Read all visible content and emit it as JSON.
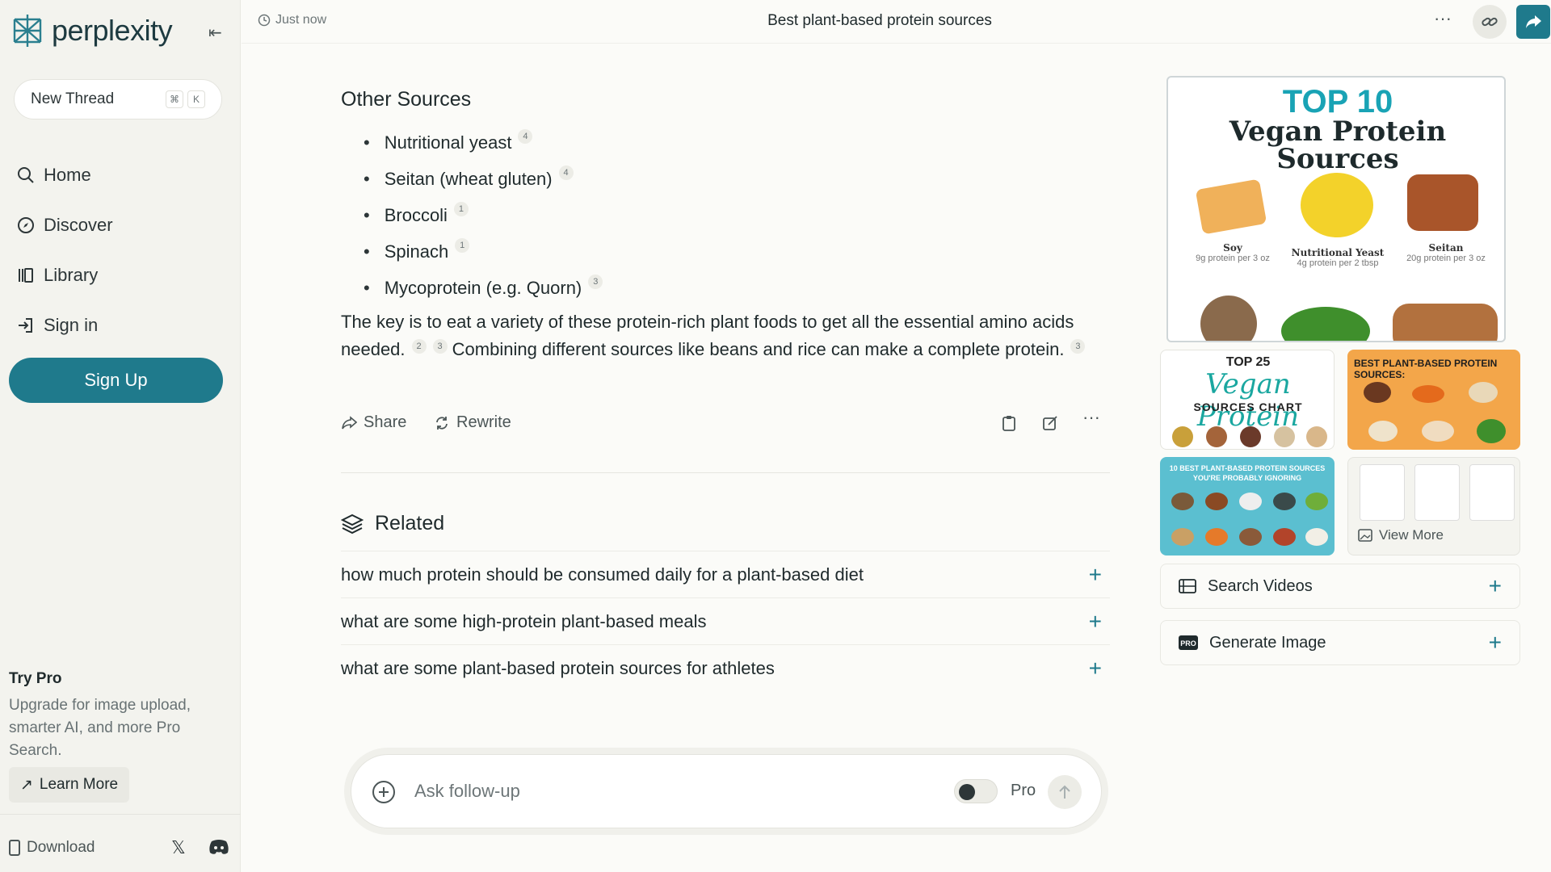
{
  "brand": {
    "name": "perplexity"
  },
  "sidebar": {
    "new_thread": "New Thread",
    "shortcut": [
      "⌘",
      "K"
    ],
    "items": [
      {
        "label": "Home",
        "icon": "search-icon"
      },
      {
        "label": "Discover",
        "icon": "compass-icon"
      },
      {
        "label": "Library",
        "icon": "library-icon"
      },
      {
        "label": "Sign in",
        "icon": "sign-in-icon"
      }
    ],
    "signup": "Sign Up",
    "trypro_title": "Try Pro",
    "trypro_desc": "Upgrade for image upload, smarter AI, and more Pro Search.",
    "learn_more": "Learn More",
    "download": "Download"
  },
  "topbar": {
    "time": "Just now",
    "title": "Best plant-based protein sources"
  },
  "answer": {
    "heading": "Other Sources",
    "bullets": [
      {
        "text": "Nutritional yeast",
        "cite": "4"
      },
      {
        "text": "Seitan (wheat gluten)",
        "cite": "4"
      },
      {
        "text": "Broccoli",
        "cite": "1"
      },
      {
        "text": "Spinach",
        "cite": "1"
      },
      {
        "text": "Mycoprotein (e.g. Quorn)",
        "cite": "3"
      }
    ],
    "para_1": "The key is to eat a variety of these protein-rich plant foods to get all the essential amino acids needed.",
    "para_cites_1": [
      "2",
      "3"
    ],
    "para_2": "Combining different sources like beans and rice can make a complete protein.",
    "para_cite_2": "3",
    "share": "Share",
    "rewrite": "Rewrite"
  },
  "related": {
    "heading": "Related",
    "items": [
      "how much protein should be consumed daily for a plant-based diet",
      "what are some high-protein plant-based meals",
      "what are some plant-based protein sources for athletes"
    ]
  },
  "ask": {
    "placeholder": "Ask follow-up",
    "pro": "Pro"
  },
  "images": {
    "hero_title_1": "TOP 10",
    "hero_title_2": "Vegan Protein Sources",
    "foods": [
      {
        "name": "Soy",
        "sub": "9g protein per 3 oz"
      },
      {
        "name": "Nutritional Yeast",
        "sub": "4g protein per 2 tbsp"
      },
      {
        "name": "Seitan",
        "sub": "20g protein per 3 oz"
      }
    ],
    "t25_a": "TOP 25",
    "t25_b": "Vegan Protein",
    "t25_c": "SOURCES CHART",
    "best": "BEST PLANT-BASED PROTEIN SOURCES:",
    "ignored": "10 BEST PLANT-BASED PROTEIN SOURCES YOU'RE PROBABLY IGNORING",
    "view_more": "View More"
  },
  "panel": {
    "search_videos": "Search Videos",
    "generate_image": "Generate Image"
  },
  "colors": {
    "accent": "#1f7a8c",
    "bg": "#fbfbf8",
    "sidebar": "#f3f3ee"
  }
}
